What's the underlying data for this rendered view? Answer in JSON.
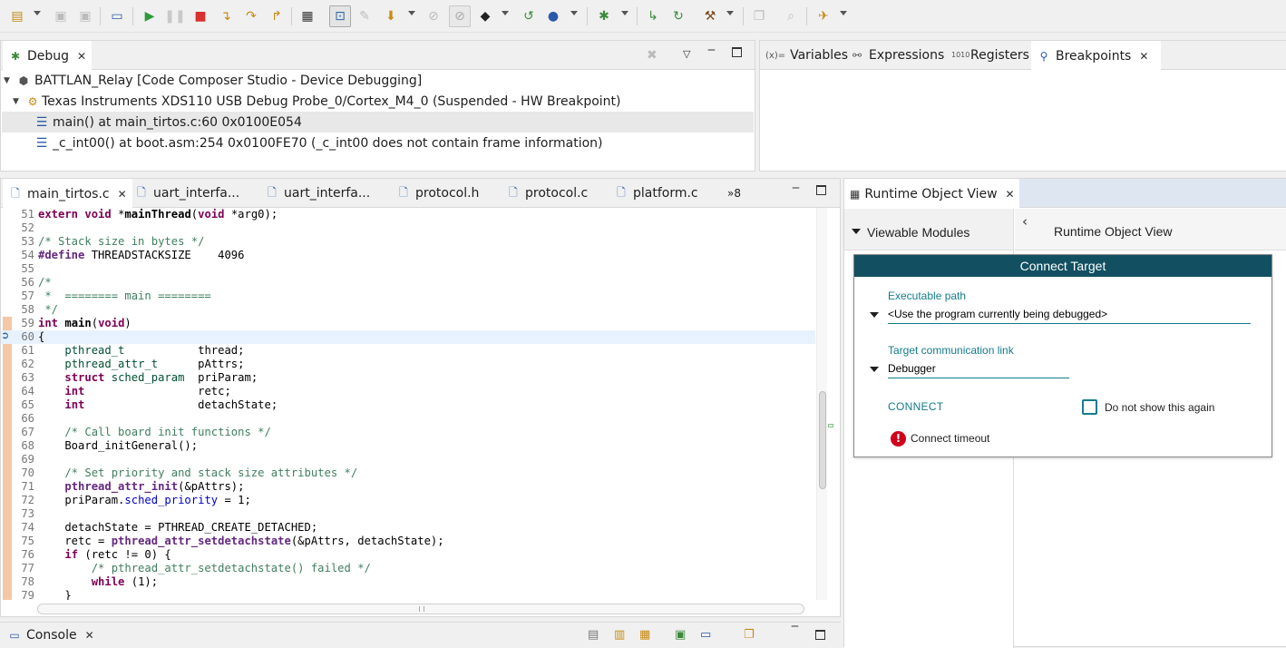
{
  "toolbar": {
    "icons": [
      "new-icon",
      "save-icon",
      "save-all-icon",
      "debug-view-icon",
      "resume-icon",
      "suspend-icon",
      "terminate-icon",
      "step-into-icon",
      "step-over-icon",
      "step-return-icon",
      "grid-icon",
      "registers-icon",
      "breakpoint-icon",
      "load-icon",
      "disable-icon",
      "restart-icon",
      "chip-icon",
      "reset-icon",
      "build-icon",
      "debug-bug-icon",
      "step-icon",
      "refresh-icon",
      "hammer-icon",
      "copy-icon",
      "search-icon",
      "run-icon"
    ]
  },
  "debug_view": {
    "tab_label": "Debug",
    "rows": [
      {
        "text": "BATTLAN_Relay [Code Composer Studio - Device Debugging]"
      },
      {
        "text": "Texas Instruments XDS110 USB Debug Probe_0/Cortex_M4_0 (Suspended - HW Breakpoint)"
      },
      {
        "text": "main() at main_tirtos.c:60 0x0100E054"
      },
      {
        "text": "_c_int00() at boot.asm:254 0x0100FE70  (_c_int00 does not contain frame information)"
      }
    ]
  },
  "variables_view": {
    "tabs": [
      {
        "label": "Variables",
        "prefix": "(x)="
      },
      {
        "label": "Expressions",
        "prefix": ""
      },
      {
        "label": "Registers",
        "prefix": "1010"
      },
      {
        "label": "Breakpoints",
        "prefix": ""
      }
    ]
  },
  "editor": {
    "tabs": [
      {
        "label": "main_tirtos.c"
      },
      {
        "label": "uart_interfa..."
      },
      {
        "label": "uart_interfa..."
      },
      {
        "label": "protocol.h"
      },
      {
        "label": "protocol.c"
      },
      {
        "label": "platform.c"
      }
    ],
    "overflow_label": "»8",
    "lines": [
      {
        "n": "51",
        "code": "extern void *mainThread(void *arg0);"
      },
      {
        "n": "52",
        "code": ""
      },
      {
        "n": "53",
        "code": "/* Stack size in bytes */"
      },
      {
        "n": "54",
        "code": "#define THREADSTACKSIZE    4096"
      },
      {
        "n": "55",
        "code": ""
      },
      {
        "n": "56",
        "code": "/*"
      },
      {
        "n": "57",
        "code": " *  ======== main ========"
      },
      {
        "n": "58",
        "code": " */"
      },
      {
        "n": "59",
        "code": "int main(void)"
      },
      {
        "n": "60",
        "code": "{"
      },
      {
        "n": "61",
        "code": "    pthread_t           thread;"
      },
      {
        "n": "62",
        "code": "    pthread_attr_t      pAttrs;"
      },
      {
        "n": "63",
        "code": "    struct sched_param  priParam;"
      },
      {
        "n": "64",
        "code": "    int                 retc;"
      },
      {
        "n": "65",
        "code": "    int                 detachState;"
      },
      {
        "n": "66",
        "code": ""
      },
      {
        "n": "67",
        "code": "    /* Call board init functions */"
      },
      {
        "n": "68",
        "code": "    Board_initGeneral();"
      },
      {
        "n": "69",
        "code": ""
      },
      {
        "n": "70",
        "code": "    /* Set priority and stack size attributes */"
      },
      {
        "n": "71",
        "code": "    pthread_attr_init(&pAttrs);"
      },
      {
        "n": "72",
        "code": "    priParam.sched_priority = 1;"
      },
      {
        "n": "73",
        "code": ""
      },
      {
        "n": "74",
        "code": "    detachState = PTHREAD_CREATE_DETACHED;"
      },
      {
        "n": "75",
        "code": "    retc = pthread_attr_setdetachstate(&pAttrs, detachState);"
      },
      {
        "n": "76",
        "code": "    if (retc != 0) {"
      },
      {
        "n": "77",
        "code": "        /* pthread_attr_setdetachstate() failed */"
      },
      {
        "n": "78",
        "code": "        while (1);"
      },
      {
        "n": "79",
        "code": "    }"
      }
    ]
  },
  "runtime_object_view": {
    "tab_label": "Runtime Object View",
    "viewable_modules_label": "Viewable Modules",
    "header_title": "Runtime Object View",
    "dialog": {
      "title": "Connect Target",
      "executable_path_label": "Executable path",
      "executable_path_value": "<Use the program currently being debugged>",
      "link_label": "Target communication link",
      "link_value": "Debugger",
      "connect_label": "CONNECT",
      "checkbox_label": "Do not show this again",
      "checkbox_checked": false,
      "error_text": "Connect timeout"
    },
    "accent_color": "#114f61"
  },
  "console_view": {
    "tab_label": "Console"
  }
}
